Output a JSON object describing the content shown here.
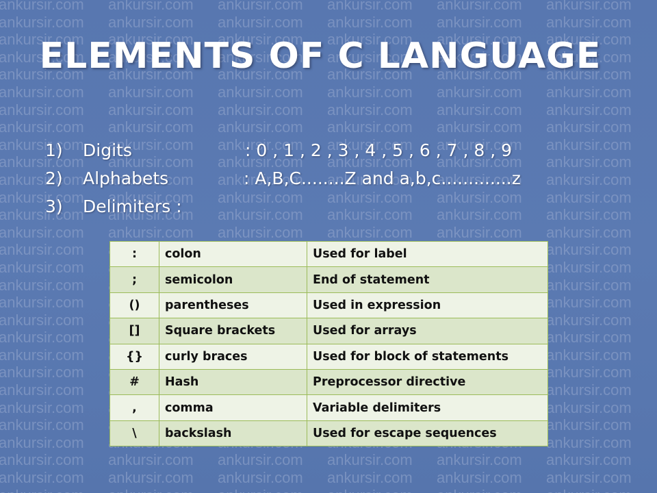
{
  "watermark": {
    "text": "ankursir.com"
  },
  "title": "ELEMENTS OF C LANGUAGE",
  "points": [
    {
      "num": "1)",
      "label": "Digits",
      "value": ": 0 , 1 , 2 , 3 , 4 , 5 , 6 , 7 , 8 , 9"
    },
    {
      "num": "2)",
      "label": "Alphabets",
      "value": ":  A,B,C........Z and a,b,c.............z"
    },
    {
      "num": "3)",
      "label": "Delimiters :",
      "value": ""
    }
  ],
  "delimiters": [
    {
      "symbol": ":",
      "name": "colon",
      "use": "Used for label"
    },
    {
      "symbol": ";",
      "name": "semicolon",
      "use": "End of statement"
    },
    {
      "symbol": "()",
      "name": "parentheses",
      "use": "Used in expression"
    },
    {
      "symbol": "[]",
      "name": "Square brackets",
      "use": "Used for arrays"
    },
    {
      "symbol": "{}",
      "name": "curly braces",
      "use": "Used  for block of statements"
    },
    {
      "symbol": "#",
      "name": "Hash",
      "use": "Preprocessor directive"
    },
    {
      "symbol": ",",
      "name": "comma",
      "use": "Variable delimiters"
    },
    {
      "symbol": "\\",
      "name": "backslash",
      "use": "Used for escape sequences"
    }
  ],
  "colors": {
    "background": "#5a78b0",
    "table_border": "#9bbb59",
    "row_light": "#eef3e6",
    "row_dark": "#dbe6ca"
  }
}
